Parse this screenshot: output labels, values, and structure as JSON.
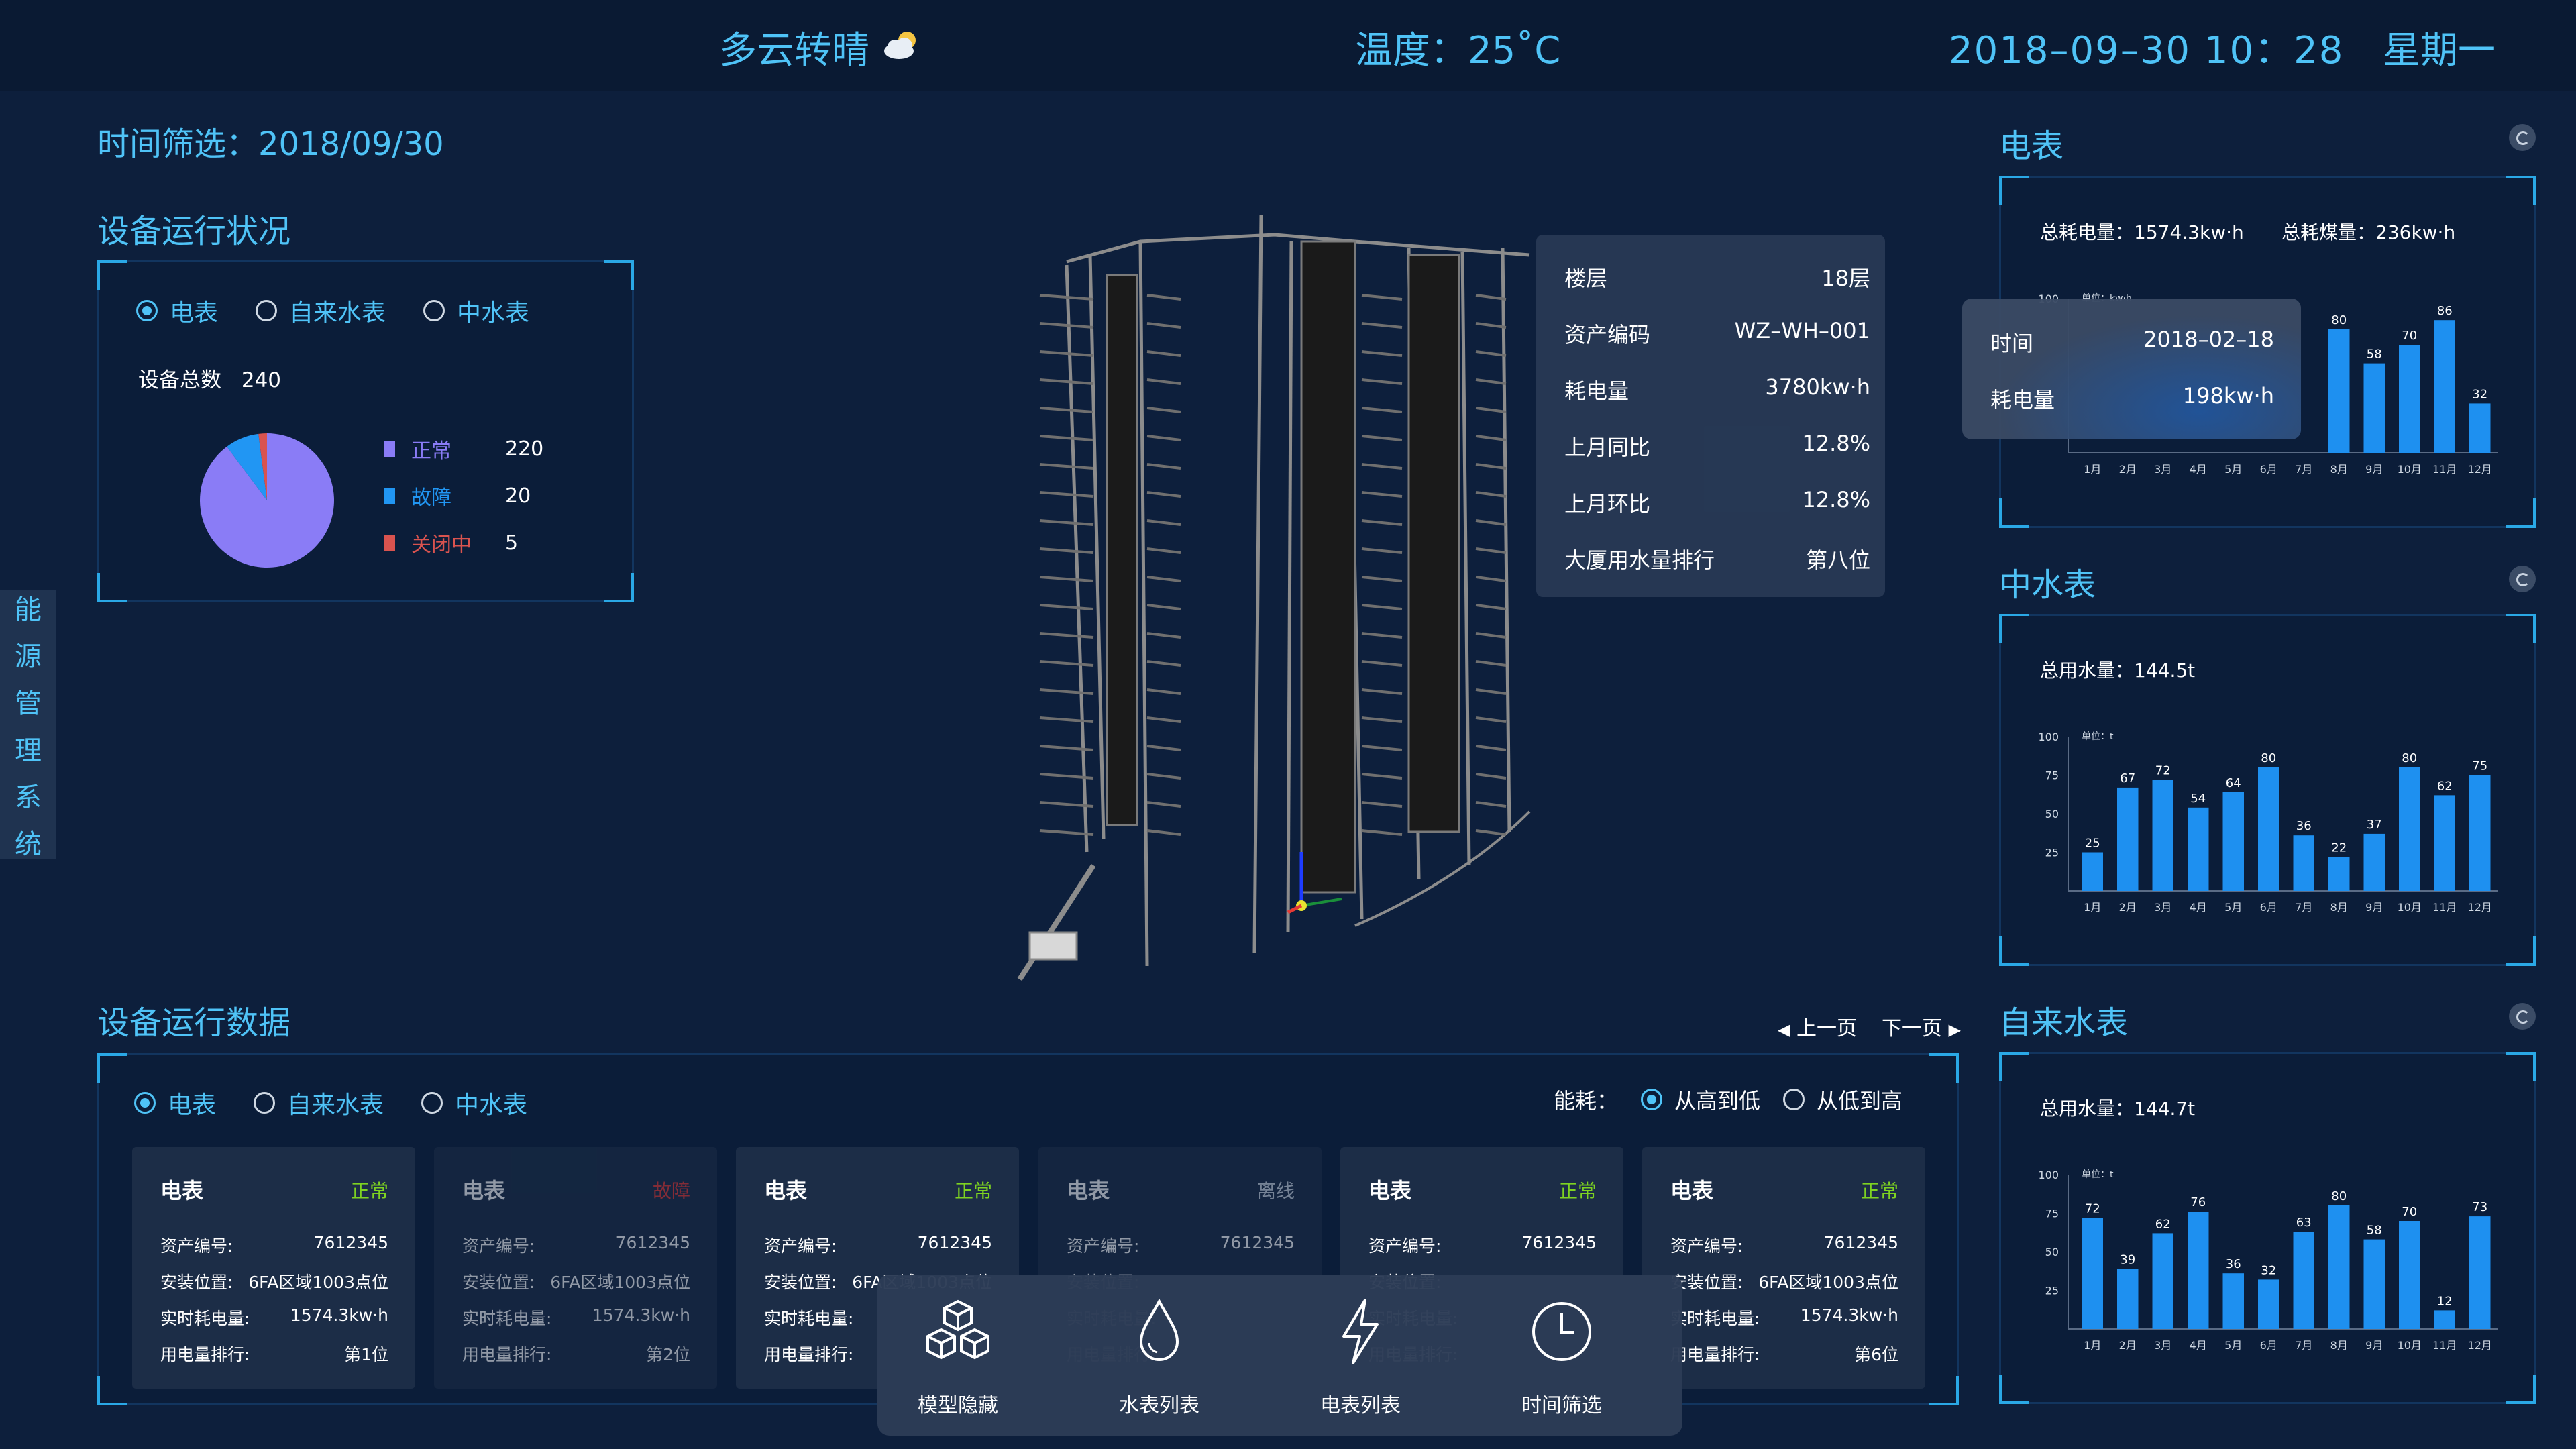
{
  "header": {
    "weather": "多云转晴",
    "temperature": "温度：25˚C",
    "datetime": "2018–09–30   10：28",
    "weekday": "星期一"
  },
  "left_tab": [
    "能",
    "源",
    "管",
    "理",
    "系",
    "统"
  ],
  "date_filter": "时间筛选：2018/09/30",
  "status": {
    "title": "设备运行状况",
    "tabs": [
      "电表",
      "自来水表",
      "中水表"
    ],
    "selected": 0,
    "total_label": "设备总数",
    "total": "240",
    "legend": [
      {
        "label": "正常",
        "value": "220",
        "color": "#8a7cf6"
      },
      {
        "label": "故障",
        "value": "20",
        "color": "#2196f3"
      },
      {
        "label": "关闭中",
        "value": "5",
        "color": "#d9534f"
      }
    ]
  },
  "info_panel": [
    {
      "label": "楼层",
      "value": "18层"
    },
    {
      "label": "资产编码",
      "value": "WZ–WH–001"
    },
    {
      "label": "耗电量",
      "value": "3780kw·h"
    },
    {
      "label": "上月同比",
      "value": "12.8%"
    },
    {
      "label": "上月环比",
      "value": "12.8%"
    },
    {
      "label": "大厦用水量排行",
      "value": "第八位"
    }
  ],
  "tooltip": [
    {
      "label": "时间",
      "value": "2018–02–18"
    },
    {
      "label": "耗电量",
      "value": "198kw·h"
    }
  ],
  "charts_titles": {
    "electric": "电表",
    "middle": "中水表",
    "tap": "自来水表"
  },
  "charts_heads": {
    "electric_power": "总耗电量：1574.3kw·h",
    "electric_coal": "总耗煤量：236kw·h",
    "middle": "总用水量：144.5t",
    "tap": "总用水量：144.7t"
  },
  "chart_data": [
    {
      "type": "bar",
      "categories": [
        "1月",
        "2月",
        "3月",
        "4月",
        "5月",
        "6月",
        "7月",
        "8月",
        "9月",
        "10月",
        "11月",
        "12月"
      ],
      "values": [
        null,
        null,
        null,
        null,
        null,
        null,
        null,
        80,
        58,
        70,
        86,
        32
      ],
      "ylim": [
        0,
        100
      ],
      "yticks": [
        100
      ],
      "unit": "单位：kw·h"
    },
    {
      "type": "bar",
      "categories": [
        "1月",
        "2月",
        "3月",
        "4月",
        "5月",
        "6月",
        "7月",
        "8月",
        "9月",
        "10月",
        "11月",
        "12月"
      ],
      "values": [
        25,
        67,
        72,
        54,
        64,
        80,
        36,
        22,
        37,
        80,
        62,
        75
      ],
      "ylim": [
        0,
        100
      ],
      "yticks": [
        25,
        50,
        75,
        100
      ],
      "unit": "单位：t"
    },
    {
      "type": "bar",
      "categories": [
        "1月",
        "2月",
        "3月",
        "4月",
        "5月",
        "6月",
        "7月",
        "8月",
        "9月",
        "10月",
        "11月",
        "12月"
      ],
      "values": [
        72,
        39,
        62,
        76,
        36,
        32,
        63,
        80,
        58,
        70,
        12,
        73
      ],
      "ylim": [
        0,
        100
      ],
      "yticks": [
        25,
        50,
        75,
        100
      ],
      "unit": "单位：t"
    }
  ],
  "device_data": {
    "title": "设备运行数据",
    "tabs": [
      "电表",
      "自来水表",
      "中水表"
    ],
    "selected": 0,
    "sort_label": "能耗：",
    "sort_options": [
      "从高到低",
      "从低到高"
    ],
    "sort_selected": 0,
    "prev": "上一页",
    "next": "下一页",
    "row_labels": [
      "资产编号:",
      "安装位置:",
      "实时耗电量:",
      "用电量排行:"
    ],
    "cards": [
      {
        "title": "电表",
        "status": "正常",
        "status_color": "#7ed321",
        "dim": false,
        "values": [
          "7612345",
          "6FA区域1003点位",
          "1574.3kw·h",
          "第1位"
        ]
      },
      {
        "title": "电表",
        "status": "故障",
        "status_color": "#e53935",
        "dim": true,
        "values": [
          "7612345",
          "6FA区域1003点位",
          "1574.3kw·h",
          "第2位"
        ]
      },
      {
        "title": "电表",
        "status": "正常",
        "status_color": "#7ed321",
        "dim": false,
        "values": [
          "7612345",
          "6FA区域1003点位",
          "",
          ""
        ]
      },
      {
        "title": "电表",
        "status": "离线",
        "status_color": "#cfd8e3",
        "dim": true,
        "values": [
          "7612345",
          "",
          "",
          ""
        ]
      },
      {
        "title": "电表",
        "status": "正常",
        "status_color": "#7ed321",
        "dim": false,
        "values": [
          "7612345",
          "",
          "",
          ""
        ]
      },
      {
        "title": "电表",
        "status": "正常",
        "status_color": "#7ed321",
        "dim": false,
        "values": [
          "7612345",
          "6FA区域1003点位",
          "1574.3kw·h",
          "第6位"
        ]
      }
    ]
  },
  "dock": [
    "模型隐藏",
    "水表列表",
    "电表列表",
    "时间筛选"
  ]
}
